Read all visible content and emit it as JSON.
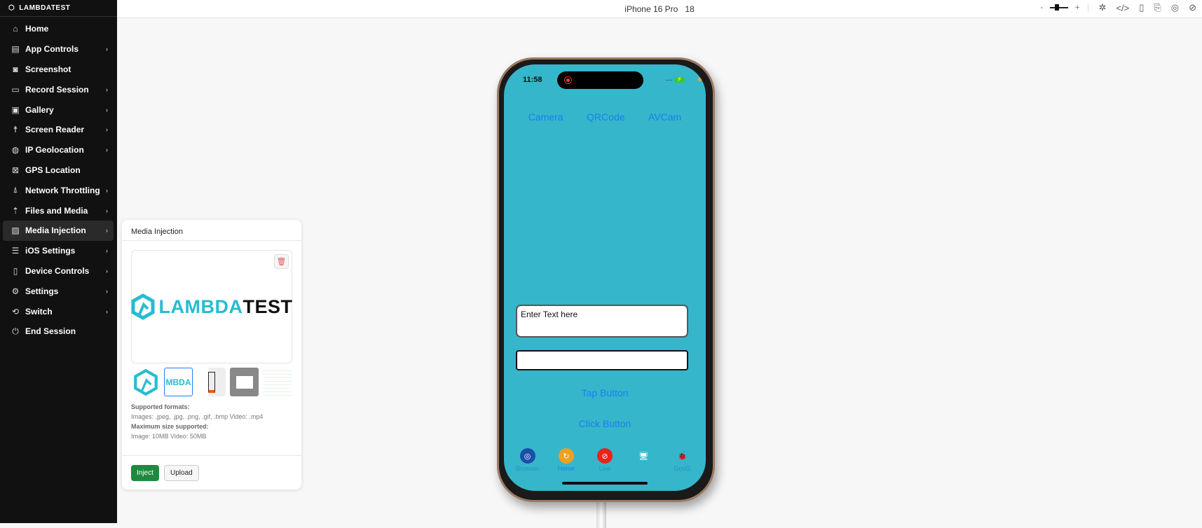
{
  "brand": "LAMBDATEST",
  "sidebar": {
    "items": [
      {
        "label": "Home",
        "icon": "home-icon",
        "glyph": "⌂",
        "chev": false
      },
      {
        "label": "App Controls",
        "icon": "app-controls-icon",
        "glyph": "▤",
        "chev": true
      },
      {
        "label": "Screenshot",
        "icon": "camera-icon",
        "glyph": "◙",
        "chev": false
      },
      {
        "label": "Record Session",
        "icon": "video-icon",
        "glyph": "▭",
        "chev": true
      },
      {
        "label": "Gallery",
        "icon": "gallery-icon",
        "glyph": "▣",
        "chev": true
      },
      {
        "label": "Screen Reader",
        "icon": "accessibility-icon",
        "glyph": "☨",
        "chev": true
      },
      {
        "label": "IP Geolocation",
        "icon": "globe-icon",
        "glyph": "◍",
        "chev": true
      },
      {
        "label": "GPS Location",
        "icon": "map-icon",
        "glyph": "⊠",
        "chev": false
      },
      {
        "label": "Network Throttling",
        "icon": "antenna-icon",
        "glyph": "⍋",
        "chev": true
      },
      {
        "label": "Files and Media",
        "icon": "upload-icon",
        "glyph": "⇡",
        "chev": true
      },
      {
        "label": "Media Injection",
        "icon": "media-injection-icon",
        "glyph": "▨",
        "chev": true,
        "active": true
      },
      {
        "label": "iOS Settings",
        "icon": "sliders-icon",
        "glyph": "☰",
        "chev": true
      },
      {
        "label": "Device Controls",
        "icon": "device-icon",
        "glyph": "▯",
        "chev": true
      },
      {
        "label": "Settings",
        "icon": "gear-icon",
        "glyph": "⚙",
        "chev": true
      },
      {
        "label": "Switch",
        "icon": "switch-icon",
        "glyph": "⟲",
        "chev": true
      },
      {
        "label": "End Session",
        "icon": "power-icon",
        "glyph": "⏻",
        "chev": false
      }
    ]
  },
  "topbar": {
    "device": "iPhone 16 Pro",
    "os_version": "18",
    "zoom_minus": "-",
    "zoom_plus": "+"
  },
  "panel": {
    "title": "Media Injection",
    "preview_logo_a": "LAMBDA",
    "preview_logo_b": "TEST",
    "thumb_text": "MBDA",
    "formats_label": "Supported formats:",
    "formats": "Images: .jpeg, .jpg, .png, .gif, .bmp  Video: .mp4",
    "size_label": "Maximum size supported:",
    "size": "Image: 10MB  Video: 50MB",
    "inject": "Inject",
    "upload": "Upload"
  },
  "phone": {
    "time": "11:58",
    "signal": "....",
    "links": [
      "Camera",
      "QRCode",
      "AVCam"
    ],
    "text_field": "Enter Text here",
    "tap_button": "Tap Button",
    "click_button": "Click Button",
    "tabs": [
      {
        "label": "Browser",
        "color": "#1a4fa8",
        "glyph": "◎"
      },
      {
        "label": "Home",
        "color": "#f0a020",
        "glyph": "↻"
      },
      {
        "label": "Live",
        "color": "#e8231a",
        "glyph": "⊘"
      },
      {
        "label": "",
        "color": "transparent",
        "glyph": "🖥"
      },
      {
        "label": "GooG",
        "color": "transparent",
        "glyph": "🐞"
      }
    ]
  },
  "colors": {
    "accent": "#1a7ff0",
    "screen": "#35b6cb",
    "inject": "#1e8a3e"
  }
}
